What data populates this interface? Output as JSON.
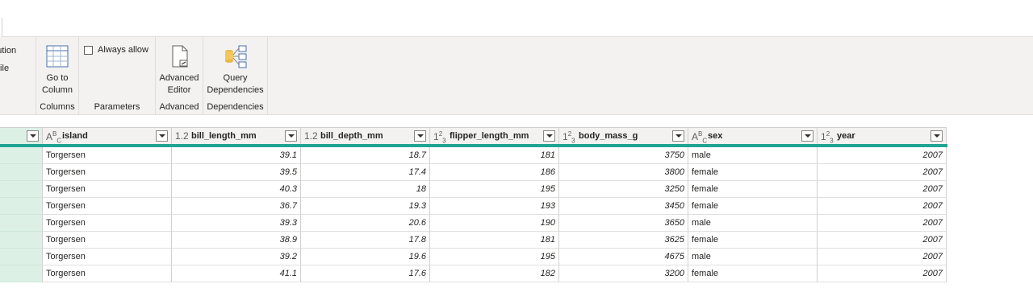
{
  "ribbon": {
    "cut_items": [
      "ribution",
      "file"
    ],
    "groups": {
      "columns": {
        "button_line1": "Go to",
        "button_line2": "Column",
        "label": "Columns"
      },
      "parameters": {
        "checkbox_label": "Always allow",
        "label": "Parameters"
      },
      "advanced": {
        "button_line1": "Advanced",
        "button_line2": "Editor",
        "label": "Advanced"
      },
      "dependencies": {
        "button_line1": "Query",
        "button_line2": "Dependencies",
        "label": "Dependencies"
      }
    }
  },
  "table": {
    "columns": [
      {
        "type": "ABC",
        "name": "island"
      },
      {
        "type": "1.2",
        "name": "bill_length_mm"
      },
      {
        "type": "1.2",
        "name": "bill_depth_mm"
      },
      {
        "type": "123",
        "name": "flipper_length_mm"
      },
      {
        "type": "123",
        "name": "body_mass_g"
      },
      {
        "type": "ABC",
        "name": "sex"
      },
      {
        "type": "123",
        "name": "year"
      }
    ],
    "rows": [
      [
        "Torgersen",
        "39.1",
        "18.7",
        "181",
        "3750",
        "male",
        "2007"
      ],
      [
        "Torgersen",
        "39.5",
        "17.4",
        "186",
        "3800",
        "female",
        "2007"
      ],
      [
        "Torgersen",
        "40.3",
        "18",
        "195",
        "3250",
        "female",
        "2007"
      ],
      [
        "Torgersen",
        "36.7",
        "19.3",
        "193",
        "3450",
        "female",
        "2007"
      ],
      [
        "Torgersen",
        "39.3",
        "20.6",
        "190",
        "3650",
        "male",
        "2007"
      ],
      [
        "Torgersen",
        "38.9",
        "17.8",
        "181",
        "3625",
        "female",
        "2007"
      ],
      [
        "Torgersen",
        "39.2",
        "19.6",
        "195",
        "4675",
        "male",
        "2007"
      ],
      [
        "Torgersen",
        "41.1",
        "17.6",
        "182",
        "3200",
        "female",
        "2007"
      ]
    ]
  },
  "colors": {
    "accent_teal": "#20a493",
    "index_column": "#ddf0e6"
  }
}
